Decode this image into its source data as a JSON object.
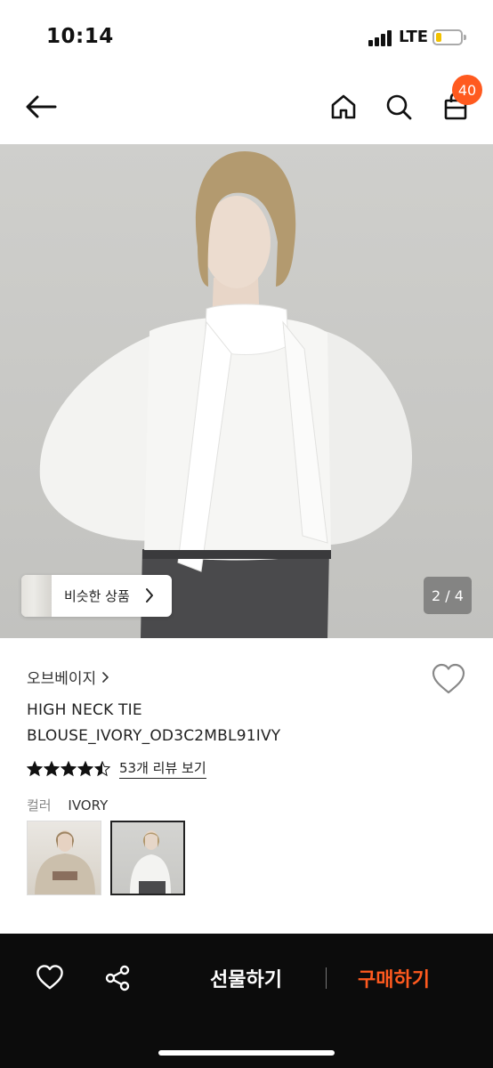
{
  "status_bar": {
    "time": "10:14",
    "network": "LTE"
  },
  "nav": {
    "cart_count": "40"
  },
  "gallery": {
    "similar_label": "비슷한 상품",
    "page_indicator": "2 / 4"
  },
  "product": {
    "brand": "오브베이지",
    "title_line1": "HIGH NECK TIE",
    "title_line2": "BLOUSE_IVORY_OD3C2MBL91IVY",
    "rating": 4.5,
    "review_link": "53개 리뷰 보기",
    "color_label": "컬러",
    "color_value": "IVORY"
  },
  "bottom_bar": {
    "gift_label": "선물하기",
    "buy_label": "구매하기"
  },
  "colors": {
    "accent": "#ff5a1f",
    "bottom_bar_bg": "#0c0c0c"
  }
}
